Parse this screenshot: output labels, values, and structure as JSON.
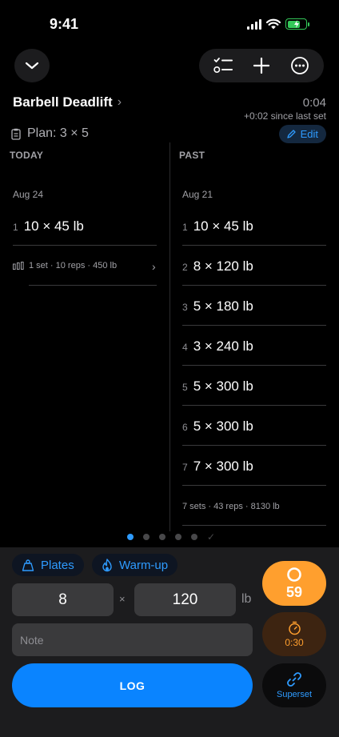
{
  "status_bar": {
    "time": "9:41"
  },
  "header": {
    "exercise_name": "Barbell Deadlift",
    "timer": "0:04",
    "since_last_set": "+0:02 since last set",
    "plan": "Plan: 3 × 5",
    "edit_label": "Edit"
  },
  "today": {
    "header": "TODAY",
    "date": "Aug 24",
    "sets": [
      {
        "index": "1",
        "value": "10 × 45 lb"
      }
    ],
    "summary": "1 set · 10 reps · 450 lb"
  },
  "past": {
    "header": "PAST",
    "date": "Aug 21",
    "sets": [
      {
        "index": "1",
        "value": "10 × 45 lb"
      },
      {
        "index": "2",
        "value": "8 × 120 lb"
      },
      {
        "index": "3",
        "value": "5 × 180 lb"
      },
      {
        "index": "4",
        "value": "3 × 240 lb"
      },
      {
        "index": "5",
        "value": "5 × 300 lb"
      },
      {
        "index": "6",
        "value": "5 × 300 lb"
      },
      {
        "index": "7",
        "value": "7 × 300 lb"
      }
    ],
    "summary": "7 sets · 43 reps · 8130 lb"
  },
  "pager": {
    "pages": 5,
    "active": 0
  },
  "entry": {
    "plates_label": "Plates",
    "warmup_label": "Warm-up",
    "reps": "8",
    "times": "×",
    "weight": "120",
    "unit": "lb",
    "note_placeholder": "Note",
    "log_label": "LOG",
    "rest_value": "59",
    "timer_value": "0:30",
    "superset_label": "Superset"
  },
  "colors": {
    "accent": "#0a84ff",
    "orange": "#ff9f2e",
    "battery": "#34c759"
  }
}
